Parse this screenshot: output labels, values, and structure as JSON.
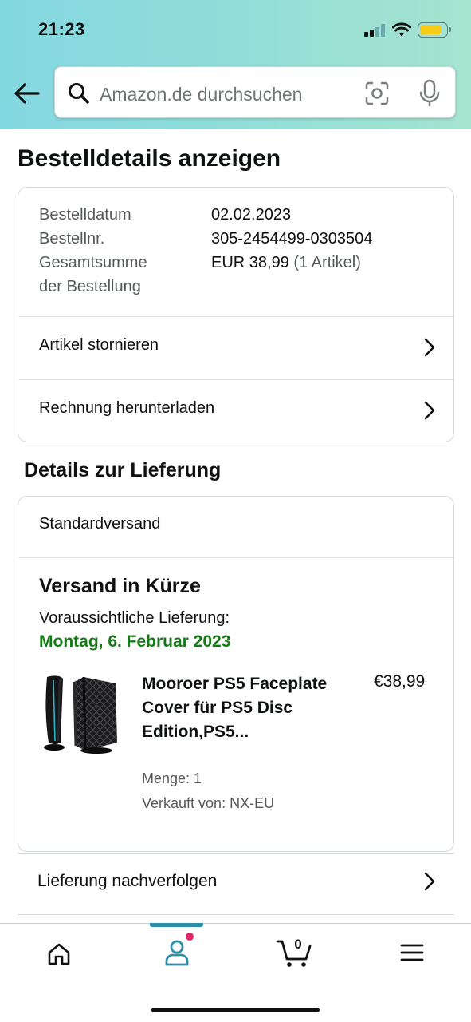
{
  "status_bar": {
    "time": "21:23"
  },
  "search": {
    "placeholder": "Amazon.de durchsuchen"
  },
  "page_title": "Bestelldetails anzeigen",
  "order_summary": {
    "rows": [
      {
        "label": "Bestelldatum",
        "value": "02.02.2023"
      },
      {
        "label": "Bestellnr.",
        "value": "305-2454499-0303504"
      }
    ],
    "total_label_line1": "Gesamtsumme",
    "total_label_line2": "der Bestellung",
    "total_value": "EUR 38,99",
    "total_items": "(1 Artikel)",
    "actions": [
      {
        "label": "Artikel stornieren"
      },
      {
        "label": "Rechnung herunterladen"
      }
    ]
  },
  "delivery_section": {
    "title": "Details zur Lieferung",
    "shipping_type": "Standardversand",
    "status": "Versand in Kürze",
    "expected_label": "Voraussichtliche Lieferung:",
    "expected_date": "Montag, 6. Februar 2023",
    "product": {
      "title": "Mooroer PS5 Faceplate Cover für PS5 Disc Edition,PS5...",
      "price": "€38,99",
      "quantity": "Menge: 1",
      "seller": "Verkauft von: NX-EU"
    },
    "track_label": "Lieferung nachverfolgen"
  },
  "tabbar": {
    "items": [
      "home-icon",
      "account-icon",
      "cart-icon",
      "menu-icon"
    ],
    "cart_count": "0",
    "active_index": 1
  },
  "colors": {
    "delivery_green": "#167a16",
    "accent_teal": "#2d8fa8",
    "notification_pink": "#e3266c",
    "battery_yellow": "#f6cc16"
  }
}
